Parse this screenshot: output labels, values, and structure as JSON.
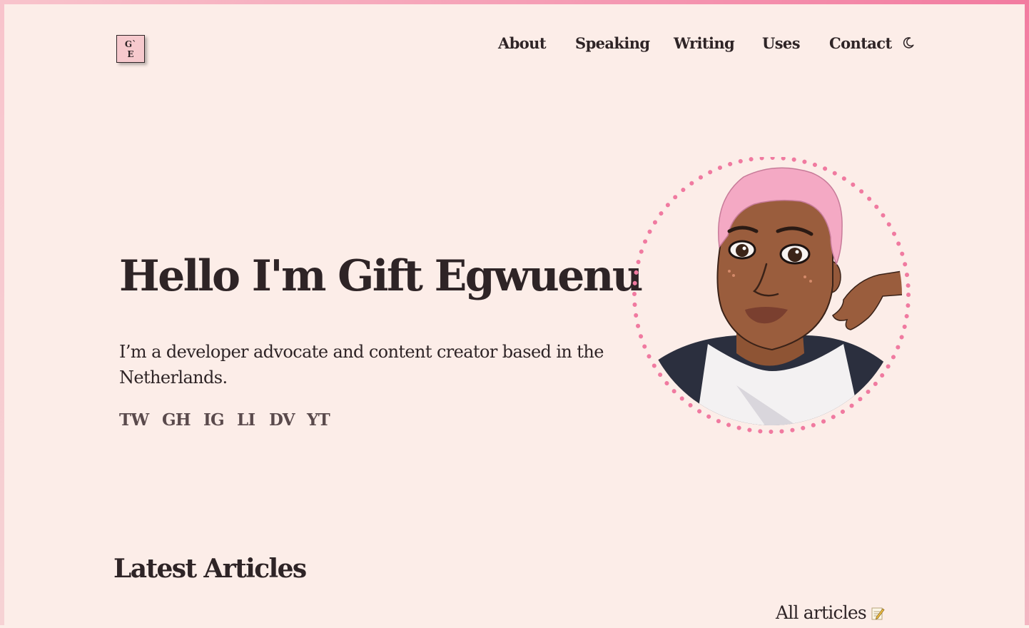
{
  "logo": {
    "line1": "G`",
    "line2": "E"
  },
  "nav": {
    "items": [
      {
        "label": "About"
      },
      {
        "label": "Speaking"
      },
      {
        "label": "Writing"
      },
      {
        "label": "Uses"
      },
      {
        "label": "Contact"
      }
    ],
    "theme_toggle_icon": "moon-icon"
  },
  "hero": {
    "title": "Hello I'm Gift Egwuenu",
    "description": "I’m a developer advocate and content creator based in the Netherlands.",
    "socials": [
      "TW",
      "GH",
      "IG",
      "LI",
      "DV",
      "YT"
    ],
    "avatar_icon": "avatar-illustration"
  },
  "articles": {
    "title": "Latest Articles",
    "all_label": "All articles",
    "all_icon": "memo-icon"
  },
  "colors": {
    "background": "#fcede8",
    "text": "#2e2426",
    "accent_pink": "#f07aa0",
    "hair_pink": "#f4a9c4",
    "skin": "#9a5d3d"
  }
}
